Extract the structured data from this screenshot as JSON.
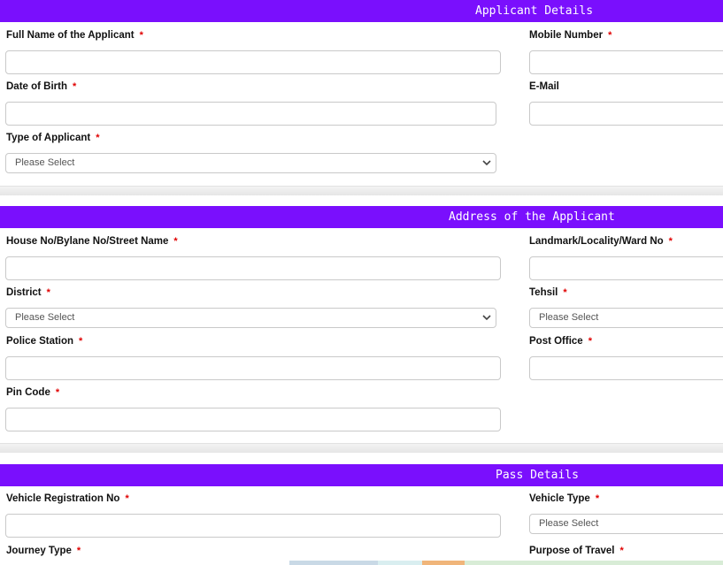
{
  "applicant_details": {
    "title": "Applicant Details",
    "full_name_label": "Full Name of the Applicant",
    "mobile_label": "Mobile Number",
    "dob_label": "Date of Birth",
    "email_label": "E-Mail",
    "type_label": "Type of Applicant",
    "type_value": "Please Select"
  },
  "address": {
    "title": "Address of the Applicant",
    "house_label": "House No/Bylane No/Street Name",
    "landmark_label": "Landmark/Locality/Ward No",
    "district_label": "District",
    "district_value": "Please Select",
    "tehsil_label": "Tehsil",
    "tehsil_value": "Please Select",
    "police_label": "Police Station",
    "post_office_label": "Post Office",
    "pin_label": "Pin Code"
  },
  "pass_details": {
    "title": "Pass Details",
    "vehicle_reg_label": "Vehicle Registration No",
    "vehicle_type_label": "Vehicle Type",
    "vehicle_type_value": "Please Select",
    "journey_label": "Journey Type",
    "purpose_label": "Purpose of Travel"
  },
  "required_mark": "*",
  "colors": {
    "header_bg": "#7a0ffd",
    "required": "#e00000"
  }
}
